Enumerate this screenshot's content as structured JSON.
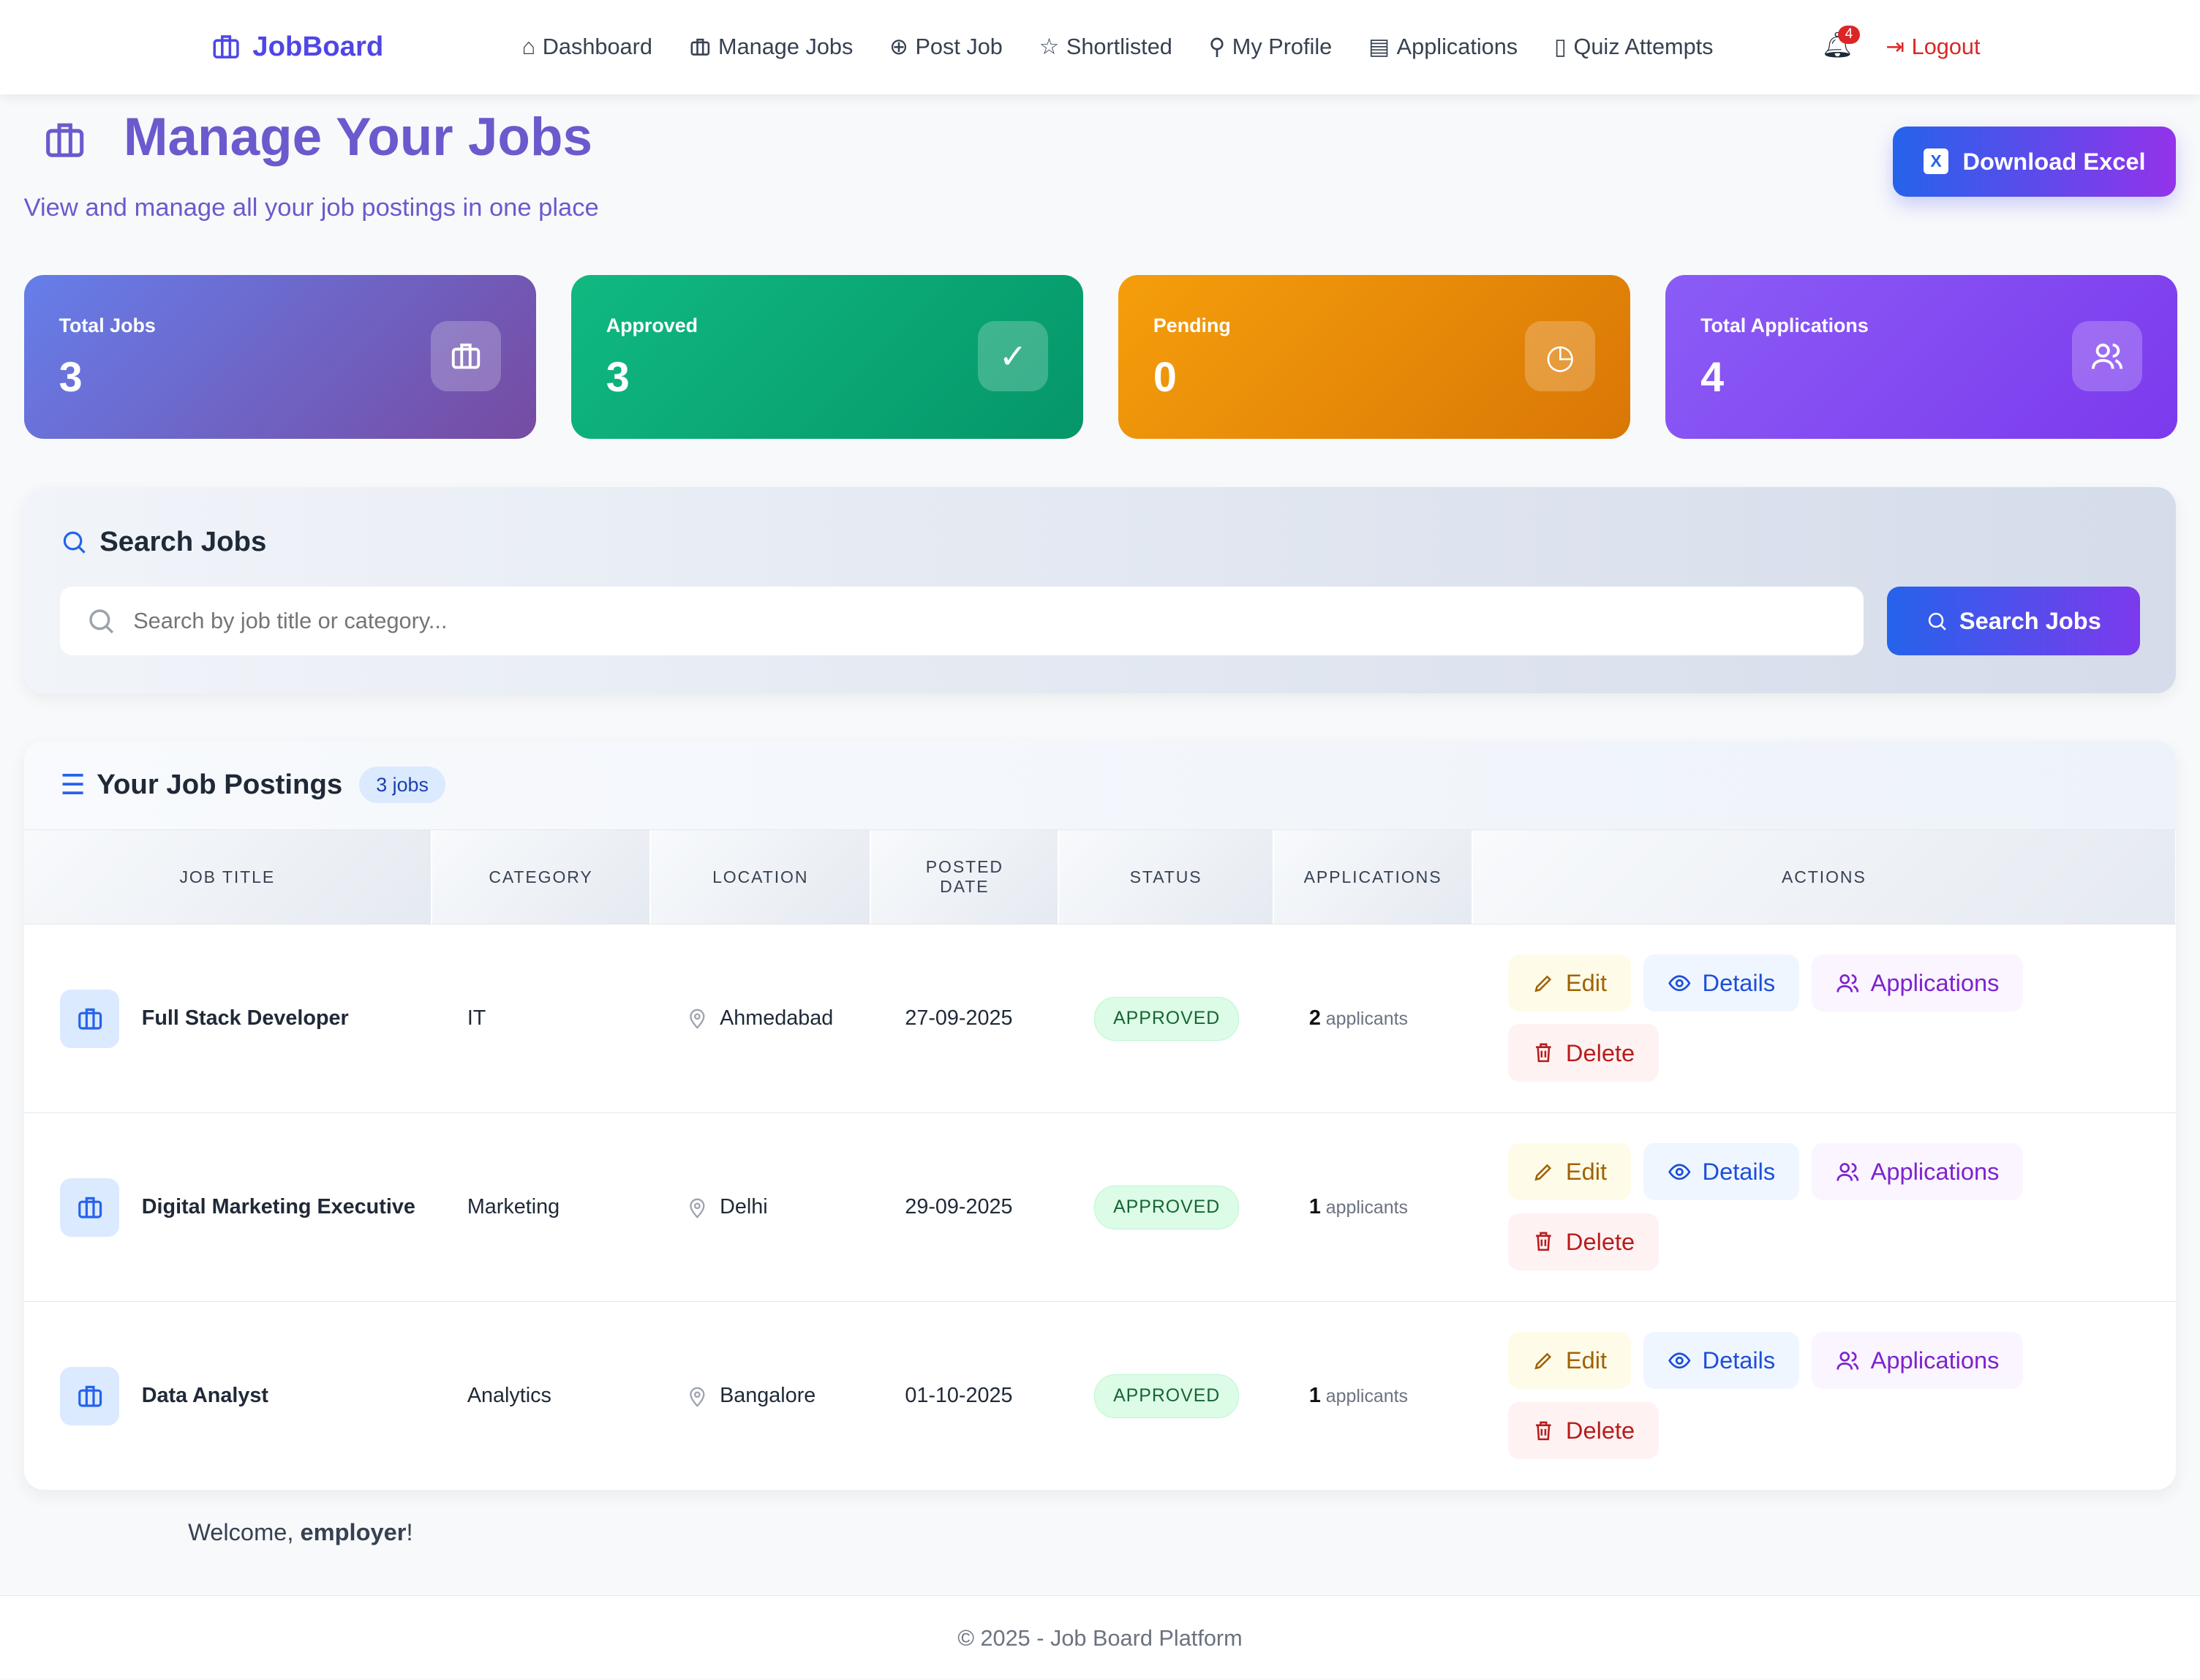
{
  "nav": {
    "brand": "JobBoard",
    "links": [
      "Dashboard",
      "Manage Jobs",
      "Post Job",
      "Shortlisted",
      "My Profile",
      "Applications",
      "Quiz Attempts"
    ],
    "notifications": "4",
    "logout": "Logout"
  },
  "header": {
    "title": "Manage Your Jobs",
    "subtitle": "View and manage all your job postings in one place",
    "download": "Download Excel"
  },
  "stats": [
    {
      "label": "Total Jobs",
      "value": "3"
    },
    {
      "label": "Approved",
      "value": "3"
    },
    {
      "label": "Pending",
      "value": "0"
    },
    {
      "label": "Total Applications",
      "value": "4"
    }
  ],
  "search": {
    "title": "Search Jobs",
    "placeholder": "Search by job title or category...",
    "button": "Search Jobs"
  },
  "table": {
    "title": "Your Job Postings",
    "count": "3 jobs",
    "columns": [
      "JOB TITLE",
      "CATEGORY",
      "LOCATION",
      "POSTED DATE",
      "STATUS",
      "APPLICATIONS",
      "ACTIONS"
    ],
    "rows": [
      {
        "title": "Full Stack Developer",
        "category": "IT",
        "location": "Ahmedabad",
        "date": "27-09-2025",
        "status": "APPROVED",
        "apps": "2",
        "apps_label": "applicants"
      },
      {
        "title": "Digital Marketing Executive",
        "category": "Marketing",
        "location": "Delhi",
        "date": "29-09-2025",
        "status": "APPROVED",
        "apps": "1",
        "apps_label": "applicants"
      },
      {
        "title": "Data Analyst",
        "category": "Analytics",
        "location": "Bangalore",
        "date": "01-10-2025",
        "status": "APPROVED",
        "apps": "1",
        "apps_label": "applicants"
      }
    ],
    "actions": {
      "edit": "Edit",
      "details": "Details",
      "applications": "Applications",
      "delete": "Delete"
    }
  },
  "welcome": {
    "prefix": "Welcome, ",
    "user": "employer",
    "suffix": "!"
  },
  "footer": "© 2025 - Job Board Platform"
}
